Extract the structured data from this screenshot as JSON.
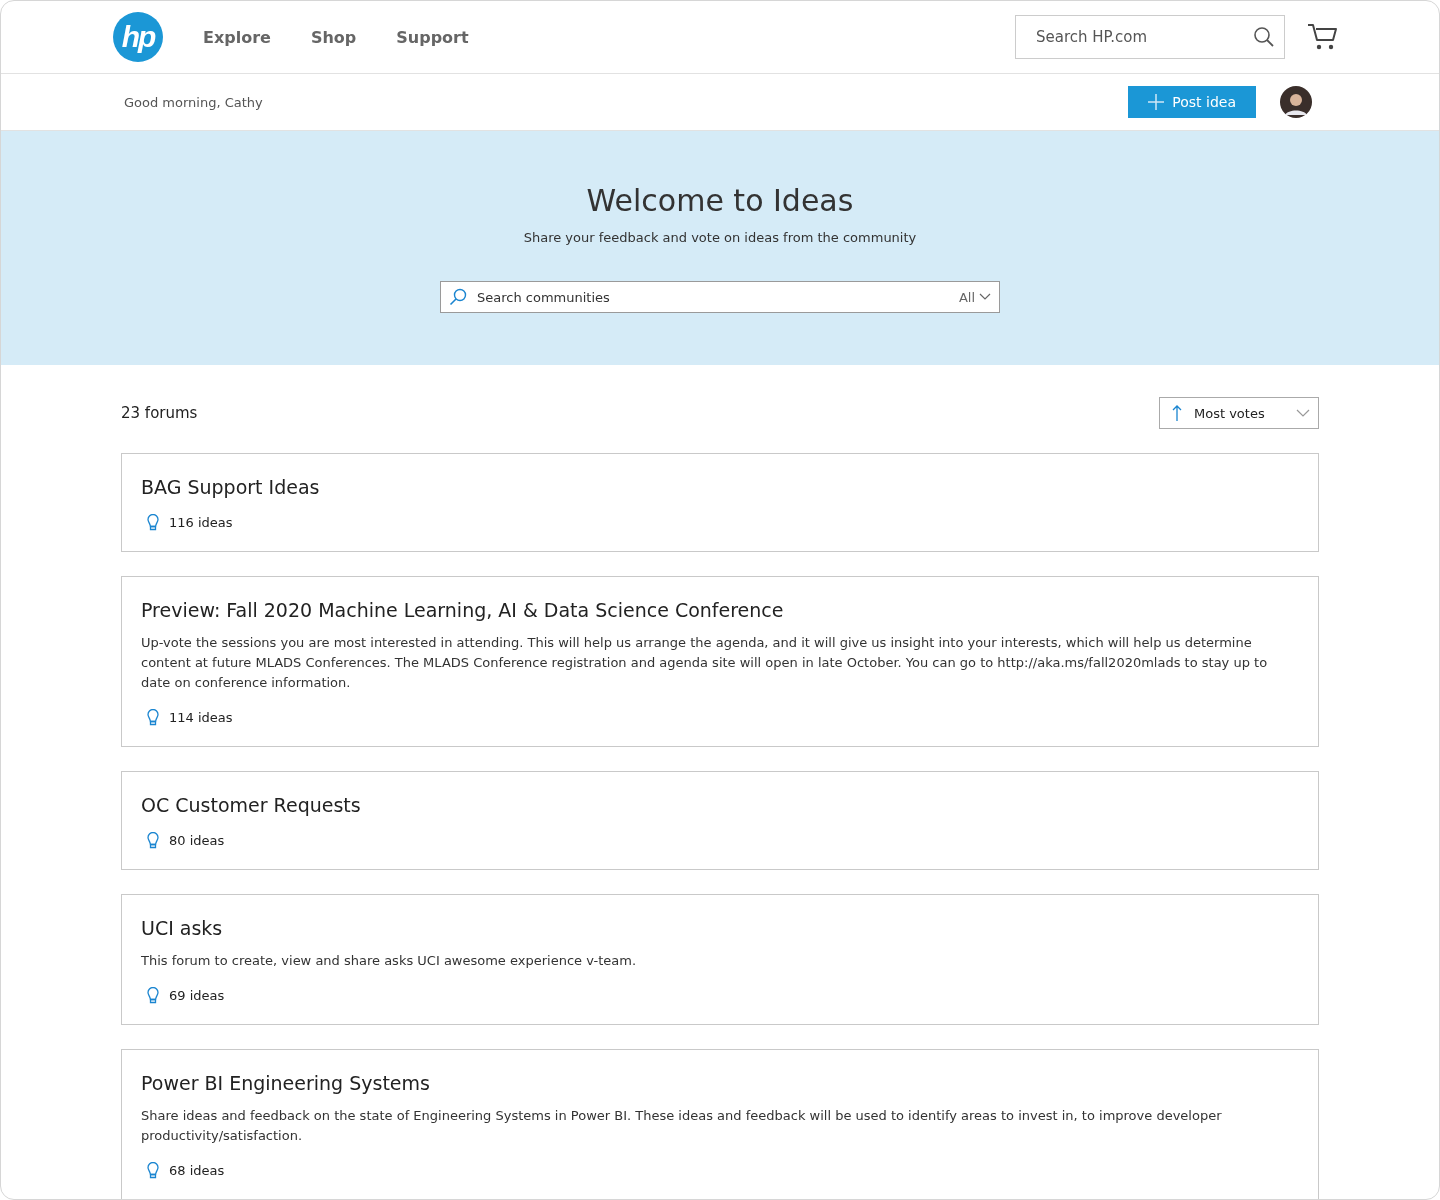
{
  "header": {
    "logo": "hp",
    "nav": [
      {
        "label": "Explore"
      },
      {
        "label": "Shop"
      },
      {
        "label": "Support"
      }
    ],
    "search": {
      "placeholder": "Search HP.com"
    }
  },
  "subheader": {
    "greeting": "Good morning, Cathy",
    "post_button": "Post idea"
  },
  "hero": {
    "title": "Welcome to Ideas",
    "subtitle": "Share your feedback and vote on ideas from the community",
    "search": {
      "placeholder": "Search communities",
      "scope": "All"
    }
  },
  "forums_count": "23 forums",
  "sort": {
    "label": "Most votes"
  },
  "forums": [
    {
      "title": "BAG Support Ideas",
      "ideas": "116 ideas"
    },
    {
      "title": "Preview: Fall 2020 Machine Learning, AI & Data Science Conference",
      "description": "Up-vote the sessions you are most interested in attending. This will help us arrange the agenda, and it will give us insight into your interests, which will help us determine content at future MLADS Conferences. The MLADS Conference registration and agenda site will open in late October. You can go to http://aka.ms/fall2020mlads to stay up to date on conference information.",
      "ideas": "114 ideas"
    },
    {
      "title": "OC Customer Requests",
      "ideas": "80 ideas"
    },
    {
      "title": "UCI asks",
      "description": "This forum to create, view and share asks UCI awesome experience v-team.",
      "ideas": "69 ideas"
    },
    {
      "title": "Power BI Engineering Systems",
      "description": "Share ideas and feedback on the state of Engineering Systems in Power BI. These ideas and feedback will be used to identify areas to invest in, to improve developer productivity/satisfaction.",
      "ideas": "68 ideas"
    }
  ]
}
